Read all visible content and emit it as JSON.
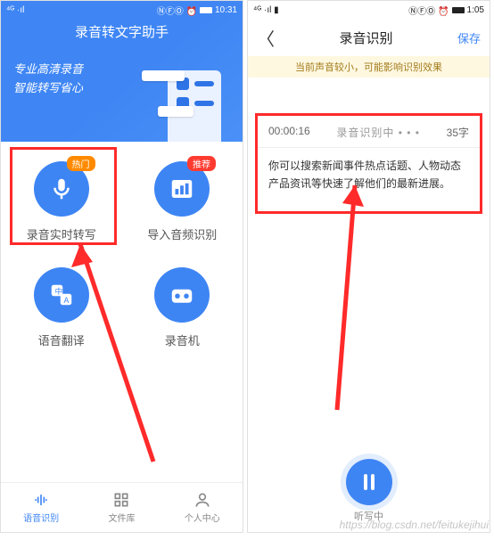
{
  "left": {
    "status": {
      "time": "10:31",
      "signal": "⁴ᴳ ·ıl",
      "icons": "ⓃⒻⓄ ⏰"
    },
    "hero": {
      "title": "录音转文字助手",
      "sub1": "专业高清录音",
      "sub2": "智能转写省心"
    },
    "features": [
      {
        "label": "录音实时转写",
        "badge": "热门",
        "badge_kind": "hot",
        "icon": "mic"
      },
      {
        "label": "导入音频识别",
        "badge": "推荐",
        "badge_kind": "rec",
        "icon": "chart"
      },
      {
        "label": "语音翻译",
        "badge": null,
        "badge_kind": null,
        "icon": "translate"
      },
      {
        "label": "录音机",
        "badge": null,
        "badge_kind": null,
        "icon": "recorder"
      }
    ],
    "nav": [
      {
        "label": "语音识别",
        "active": true
      },
      {
        "label": "文件库",
        "active": false
      },
      {
        "label": "个人中心",
        "active": false
      }
    ]
  },
  "right": {
    "status": {
      "time": "1:05",
      "signal": "⁴ᴳ ·ıl ▮",
      "icons": "ⓃⒻⓄ ⏰"
    },
    "topbar": {
      "back": "〈",
      "title": "录音识别",
      "save": "保存"
    },
    "warn": "当前声音较小，可能影响识别效果",
    "box": {
      "time": "00:00:16",
      "status": "录音识别中 • • •",
      "count": "35字",
      "text": "你可以搜索新闻事件热点话题、人物动态产品资讯等快速了解他们的最新进展。"
    },
    "rec_label": "听写中"
  },
  "watermark": "https://blog.csdn.net/feitukejihui"
}
